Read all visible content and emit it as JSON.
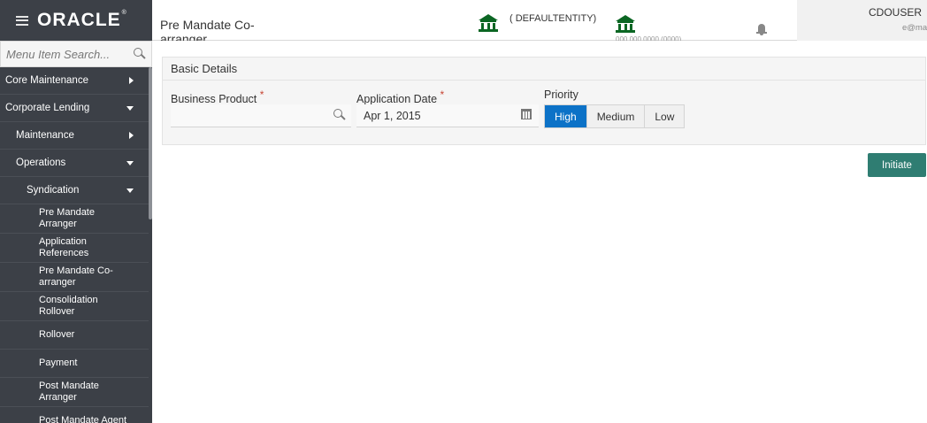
{
  "app": {
    "logo": "ORACLE",
    "logo_mark": "®"
  },
  "header": {
    "page_title": "Pre Mandate Co-arranger",
    "entity": "( DEFAULTENTITY)",
    "branch": "000 000 0000 (0000)",
    "user_name": "CDOUSER",
    "user_email": "e@mail.com"
  },
  "sidebar": {
    "search_placeholder": "Menu Item Search...",
    "items": [
      {
        "label": "Core Maintenance",
        "level": 1,
        "caret": "right"
      },
      {
        "label": "Corporate Lending",
        "level": 1,
        "caret": "down"
      },
      {
        "label": "Maintenance",
        "level": 2,
        "caret": "right"
      },
      {
        "label": "Operations",
        "level": 2,
        "caret": "down"
      },
      {
        "label": "Syndication",
        "level": 3,
        "caret": "down"
      },
      {
        "label": "Pre Mandate Arranger",
        "level": 4
      },
      {
        "label": "Application References",
        "level": 4
      },
      {
        "label": "Pre Mandate Co-arranger",
        "level": 4
      },
      {
        "label": "Consolidation Rollover",
        "level": 4
      },
      {
        "label": "Rollover",
        "level": 4
      },
      {
        "label": "Payment",
        "level": 4
      },
      {
        "label": "Post Mandate Arranger",
        "level": 4
      },
      {
        "label": "Post Mandate Agent",
        "level": 4
      }
    ]
  },
  "form": {
    "section_title": "Basic Details",
    "business_product": {
      "label": "Business Product",
      "required": "*",
      "value": ""
    },
    "application_date": {
      "label": "Application Date",
      "required": "*",
      "value": "Apr 1, 2015"
    },
    "priority": {
      "label": "Priority",
      "options": [
        "High",
        "Medium",
        "Low"
      ],
      "selected": "High"
    },
    "initiate_label": "Initiate"
  },
  "colors": {
    "sidebar_bg": "#3c4047",
    "accent_blue": "#0c72c7",
    "initiate_green": "#2f7d72",
    "bank_icon_green": "#0b6623",
    "required_red": "#c74634"
  },
  "icons": {
    "menu": "hamburger-icon",
    "search": "search-icon",
    "calendar": "calendar-icon",
    "bank": "bank-icon",
    "notifications": "bell-icon"
  }
}
